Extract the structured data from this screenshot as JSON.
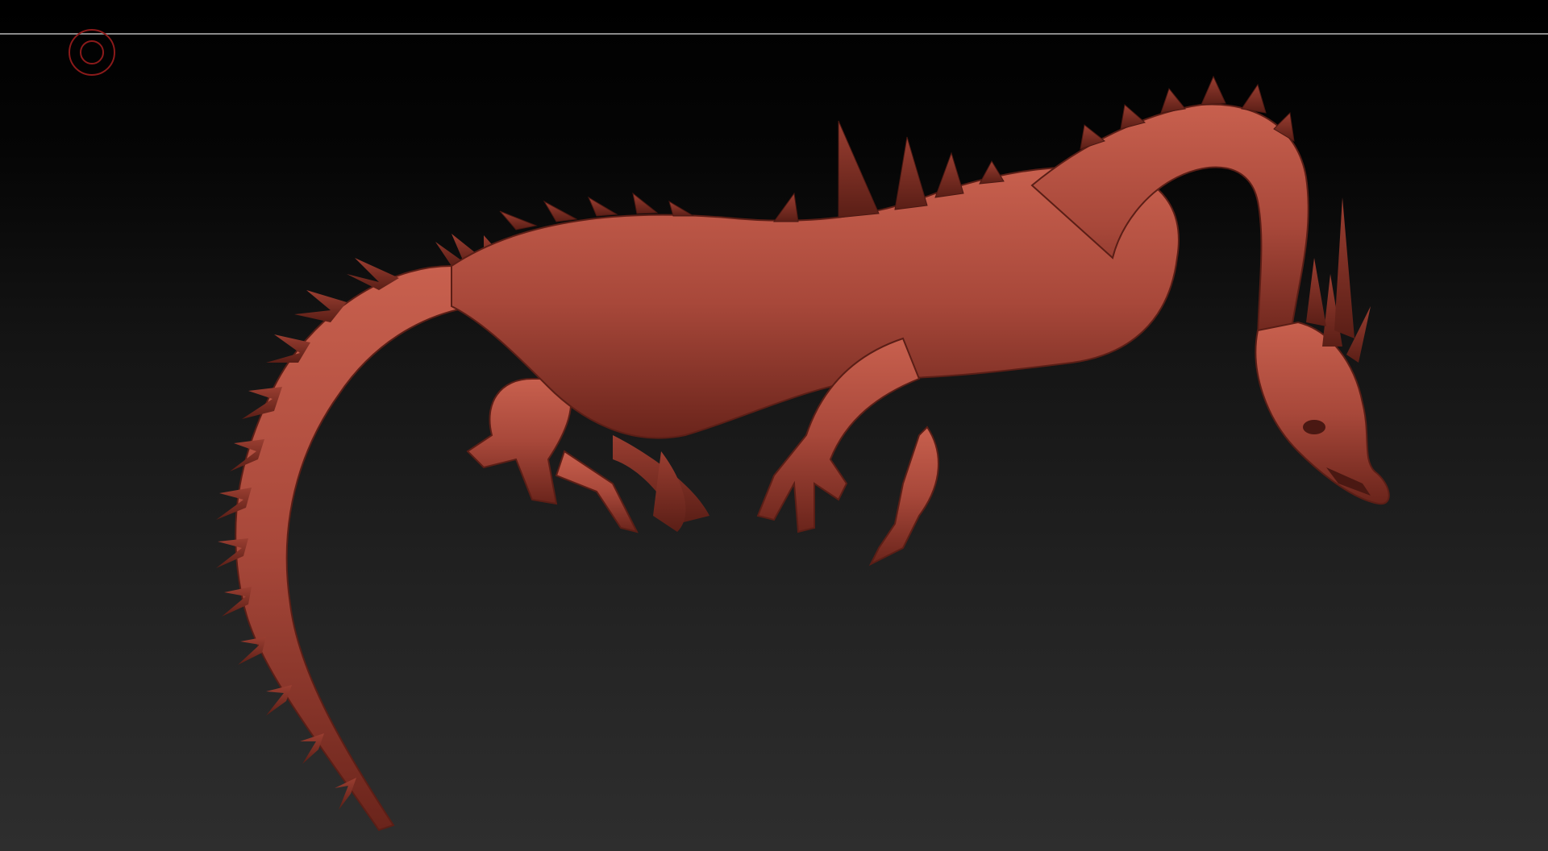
{
  "viewport": {
    "background_top": "#000000",
    "background_bottom": "#2e2e2e",
    "divider_color": "#8a8a8a"
  },
  "brush_cursor": {
    "icon": "brush-circle-icon",
    "color": "#8b1a1a"
  },
  "model": {
    "subject": "dragon-sculpt",
    "material_color": "#a8483a",
    "highlight_color": "#c8604e",
    "shadow_color": "#5a1e16"
  }
}
